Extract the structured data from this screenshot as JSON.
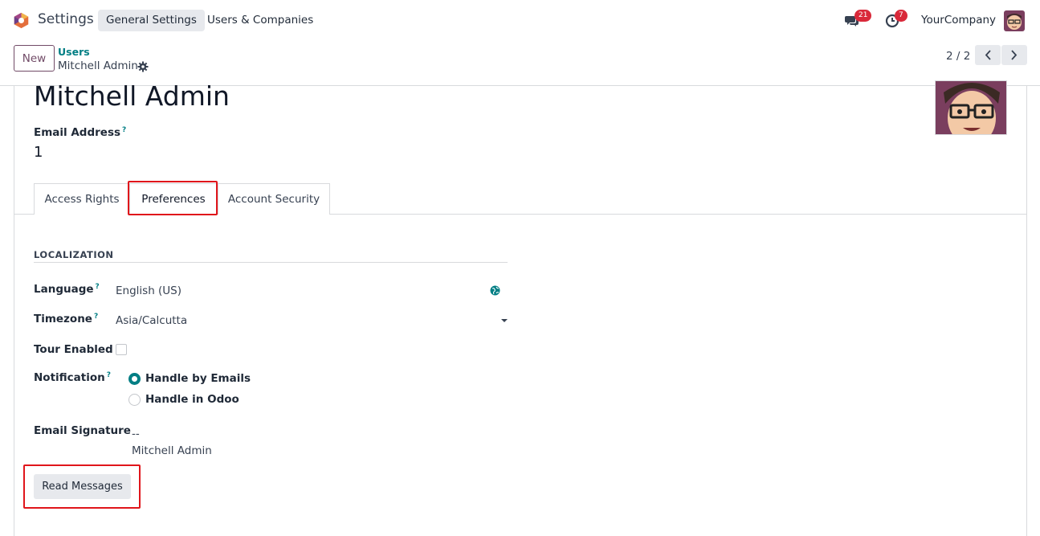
{
  "navbar": {
    "app_name": "Settings",
    "menu": [
      {
        "label": "General Settings"
      },
      {
        "label": "Users & Companies"
      }
    ],
    "messages_count": "21",
    "activities_count": "7",
    "company": "YourCompany"
  },
  "control_panel": {
    "new_label": "New",
    "breadcrumb_parent": "Users",
    "breadcrumb_current": "Mitchell Admin",
    "pager": "2 / 2"
  },
  "form": {
    "name": "Mitchell Admin",
    "email_label": "Email Address",
    "email_value": "1",
    "help_mark": "?",
    "tabs": [
      {
        "label": "Access Rights"
      },
      {
        "label": "Preferences"
      },
      {
        "label": "Account Security"
      }
    ],
    "section_title": "LOCALIZATION",
    "language_label": "Language",
    "language_value": "English (US)",
    "timezone_label": "Timezone",
    "timezone_value": "Asia/Calcutta",
    "tour_label": "Tour Enabled",
    "notification_label": "Notification",
    "notification_options": [
      {
        "label": "Handle by Emails",
        "selected": true
      },
      {
        "label": "Handle in Odoo",
        "selected": false
      }
    ],
    "signature_label": "Email Signature",
    "signature_line1": "--",
    "signature_line2": "Mitchell Admin",
    "read_messages_label": "Read Messages"
  },
  "colors": {
    "accent": "#017e84",
    "brand": "#714b67",
    "highlight": "#e0151b",
    "badge": "#d9293a"
  }
}
